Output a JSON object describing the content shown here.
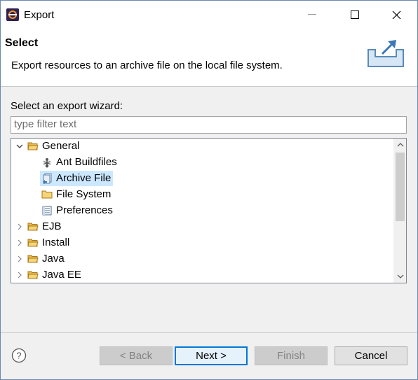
{
  "window": {
    "title": "Export",
    "icon": "eclipse-icon"
  },
  "header": {
    "title": "Select",
    "description": "Export resources to an archive file on the local file system.",
    "banner_icon": "export-wizard-icon"
  },
  "wizard": {
    "label": "Select an export wizard:",
    "filter_placeholder": "type filter text",
    "filter_value": ""
  },
  "tree": {
    "items": [
      {
        "label": "General",
        "type": "folder",
        "expanded": true,
        "level": 0
      },
      {
        "label": "Ant Buildfiles",
        "type": "ant-icon",
        "level": 1
      },
      {
        "label": "Archive File",
        "type": "archive-icon",
        "level": 1,
        "selected": true
      },
      {
        "label": "File System",
        "type": "folder",
        "level": 1
      },
      {
        "label": "Preferences",
        "type": "preferences-icon",
        "level": 1
      },
      {
        "label": "EJB",
        "type": "folder",
        "expanded": false,
        "level": 0
      },
      {
        "label": "Install",
        "type": "folder",
        "expanded": false,
        "level": 0
      },
      {
        "label": "Java",
        "type": "folder",
        "expanded": false,
        "level": 0
      },
      {
        "label": "Java EE",
        "type": "folder",
        "expanded": false,
        "level": 0
      }
    ]
  },
  "buttons": {
    "back": "< Back",
    "next": "Next >",
    "finish": "Finish",
    "cancel": "Cancel",
    "help_icon": "help-icon"
  },
  "colors": {
    "selection": "#cce8ff",
    "default_button_border": "#0078d7"
  }
}
